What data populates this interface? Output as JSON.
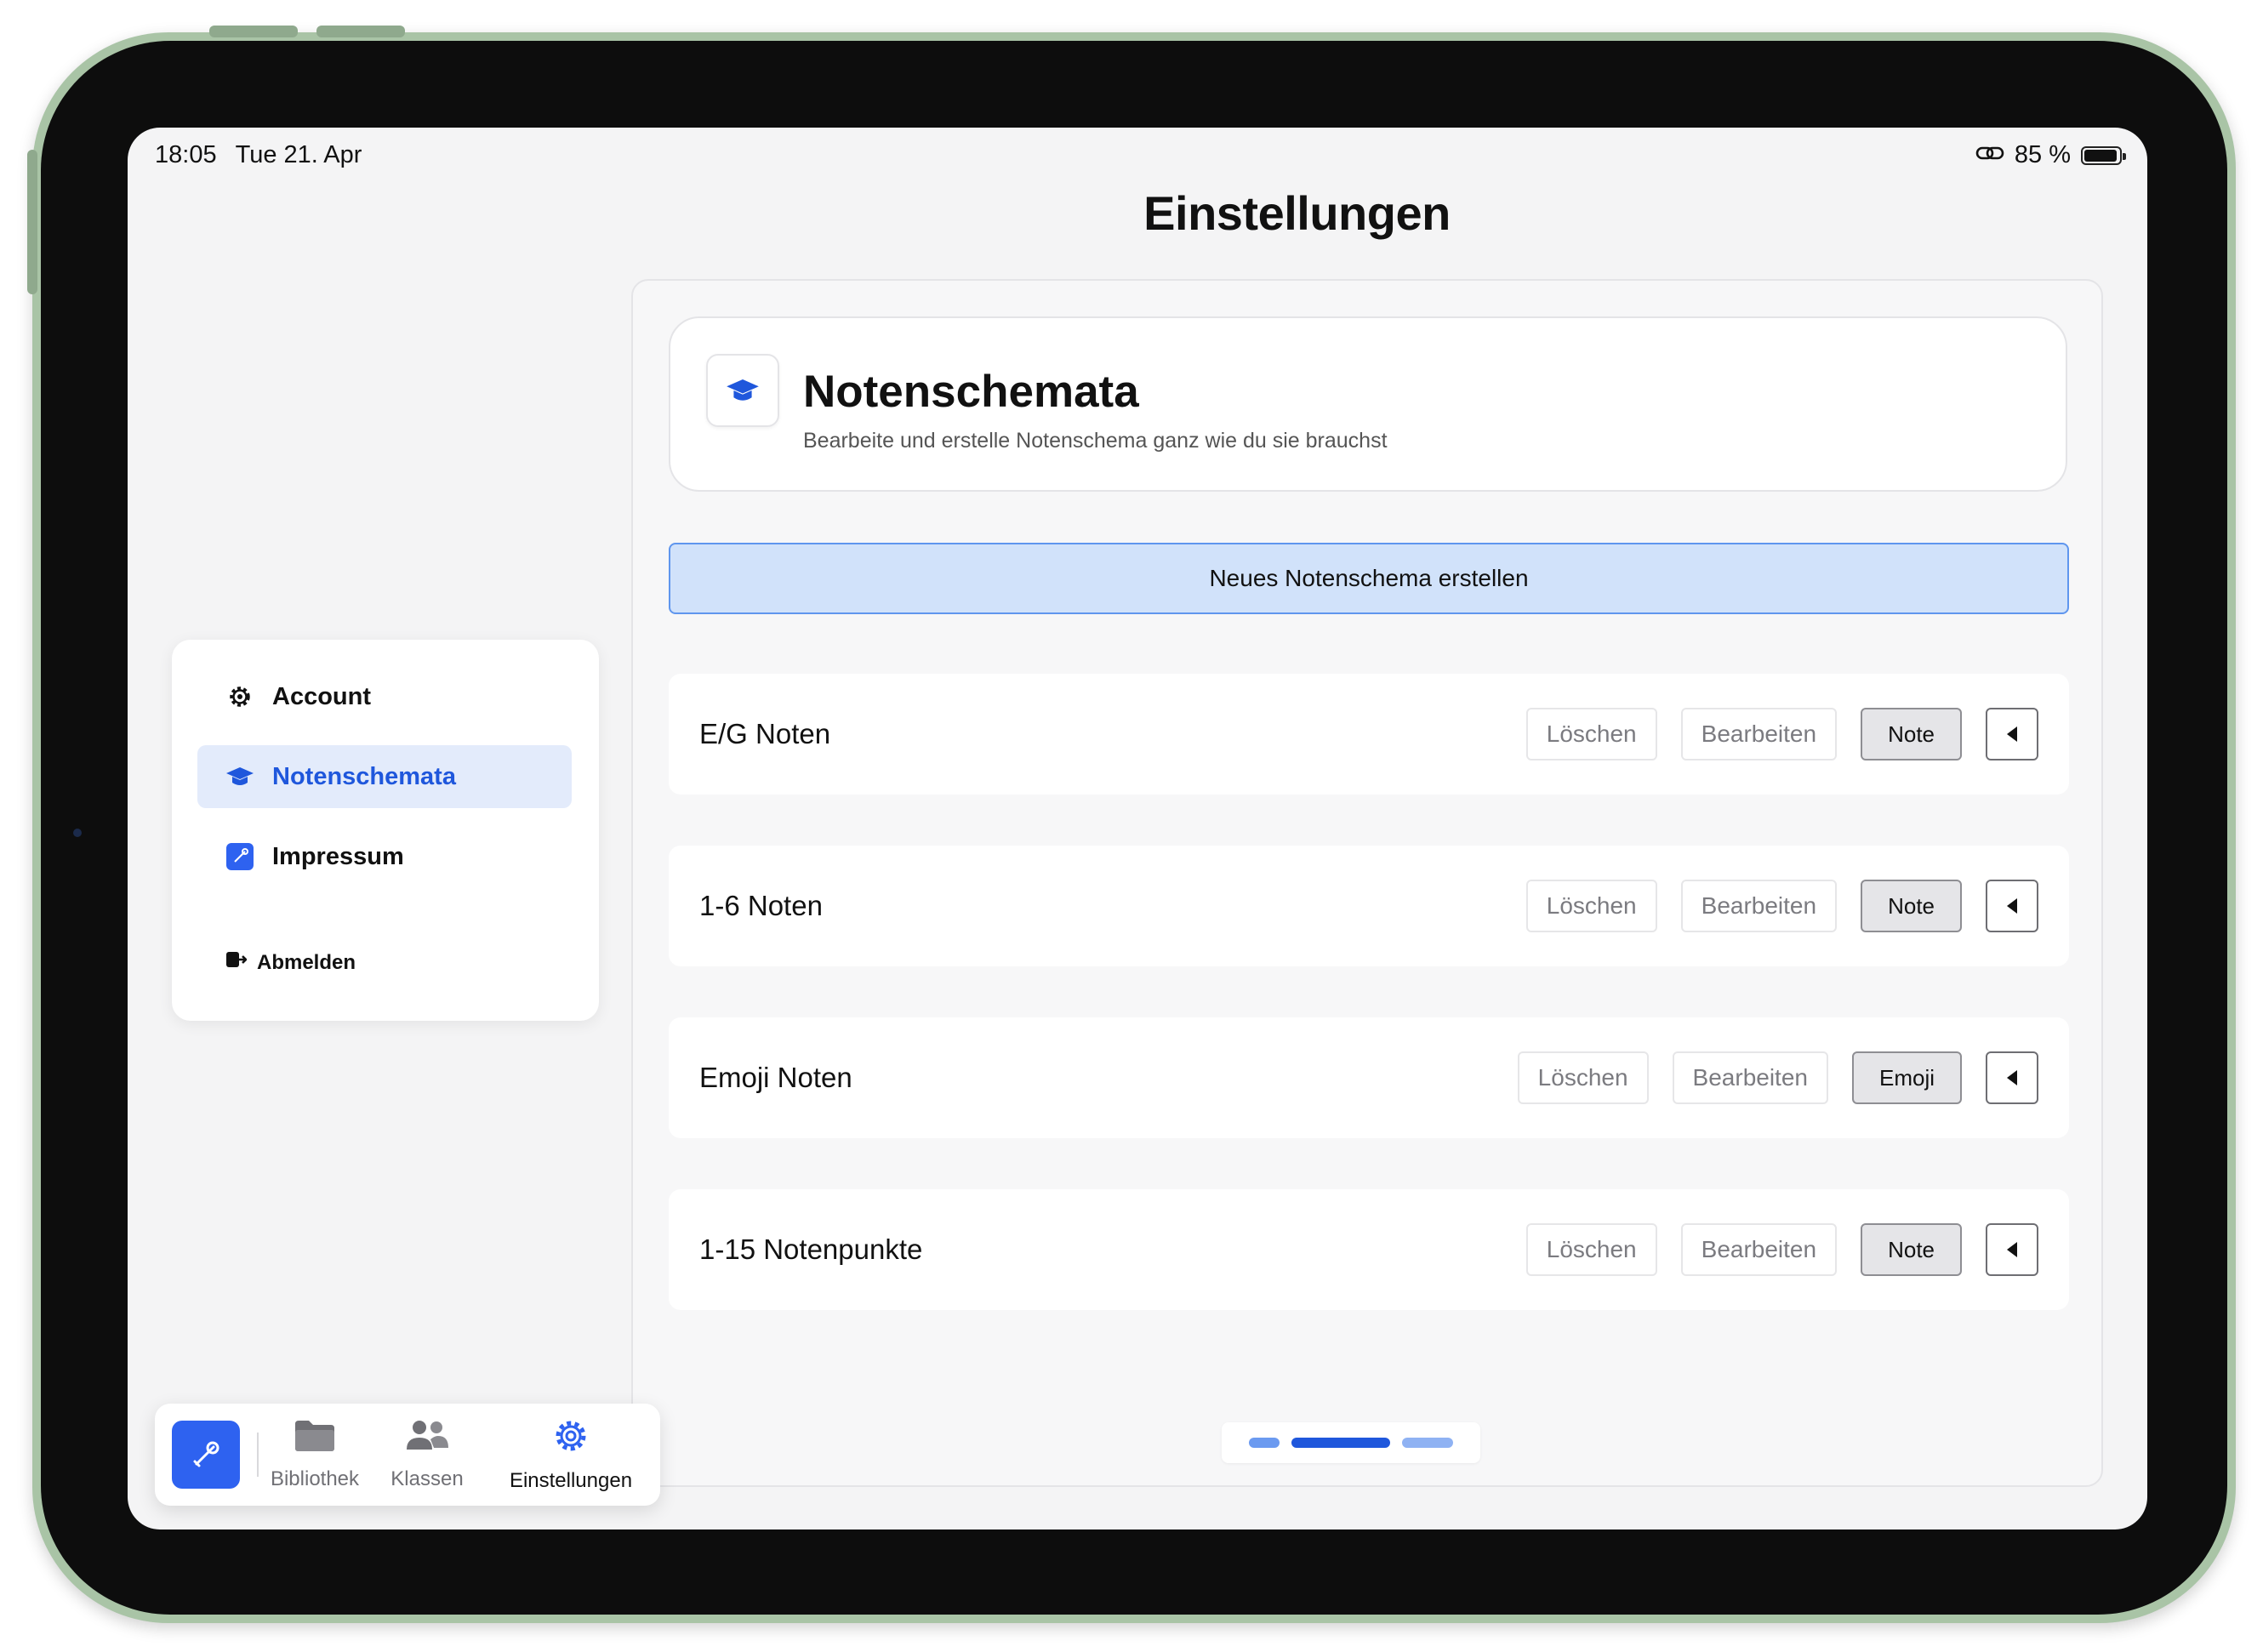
{
  "status_bar": {
    "time": "18:05",
    "date": "Tue 21. Apr",
    "battery_label": "85 %",
    "battery_level": 0.85
  },
  "page": {
    "title": "Einstellungen"
  },
  "sidebar": {
    "items": [
      {
        "label": "Account",
        "icon": "gear-icon",
        "active": false
      },
      {
        "label": "Notenschemata",
        "icon": "graduation-cap-icon",
        "active": true
      },
      {
        "label": "Impressum",
        "icon": "app-logo-icon",
        "active": false
      }
    ],
    "logout_label": "Abmelden"
  },
  "section": {
    "title": "Notenschemata",
    "subtitle": "Bearbeite und erstelle Notenschema ganz wie du sie brauchst",
    "icon": "graduation-cap-icon",
    "create_button": "Neues Notenschema erstellen"
  },
  "schemes": [
    {
      "name": "E/G Noten",
      "delete": "Löschen",
      "edit": "Bearbeiten",
      "type": "Note"
    },
    {
      "name": "1-6 Noten",
      "delete": "Löschen",
      "edit": "Bearbeiten",
      "type": "Note"
    },
    {
      "name": "Emoji Noten",
      "delete": "Löschen",
      "edit": "Bearbeiten",
      "type": "Emoji"
    },
    {
      "name": "1-15 Notenpunkte",
      "delete": "Löschen",
      "edit": "Bearbeiten",
      "type": "Note"
    }
  ],
  "pager": {
    "pages": 3,
    "current": 2
  },
  "tabbar": {
    "items": [
      {
        "label": "Bibliothek",
        "icon": "folder-icon",
        "active": false
      },
      {
        "label": "Klassen",
        "icon": "people-icon",
        "active": false
      },
      {
        "label": "Einstellungen",
        "icon": "gear-icon",
        "active": true
      }
    ]
  },
  "colors": {
    "accent": "#2e62f0",
    "active_text": "#1f57dc",
    "active_bg": "#e3ebfb",
    "create_button_bg": "#d1e2fa",
    "create_button_border": "#5f96ee",
    "device_frame": "#a9c4a6"
  }
}
